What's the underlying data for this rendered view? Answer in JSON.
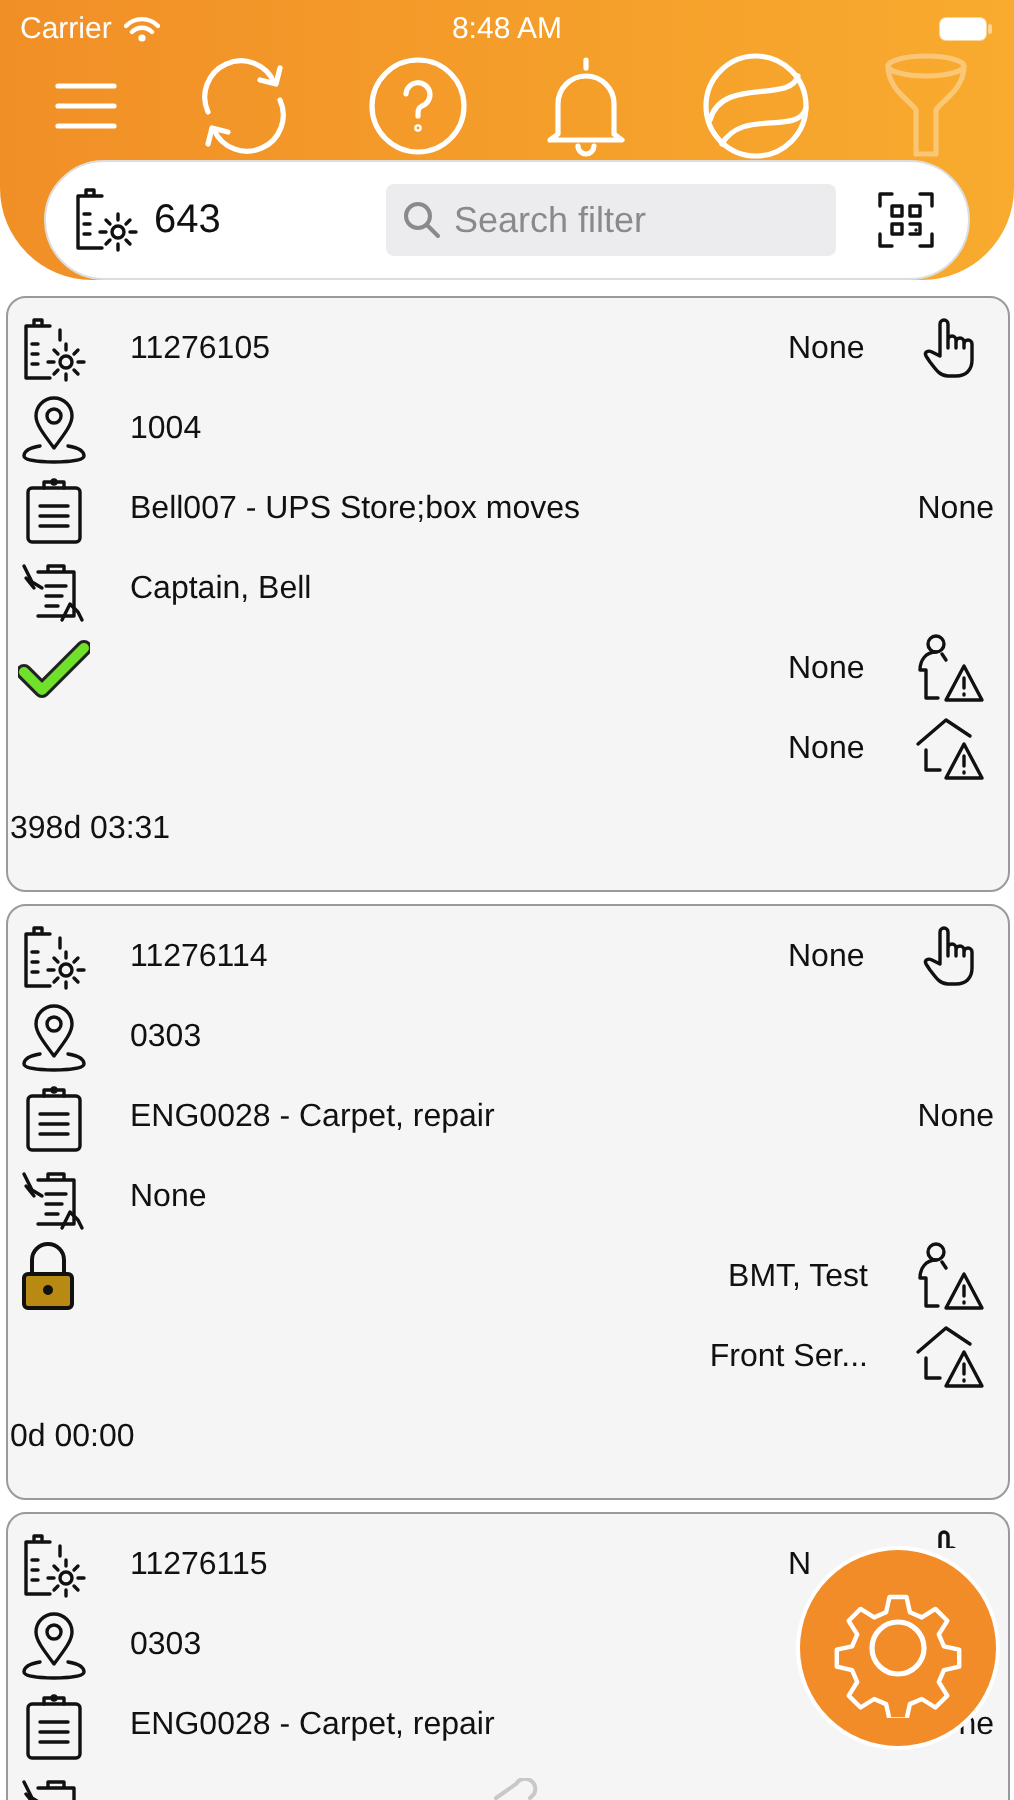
{
  "status_bar": {
    "carrier": "Carrier",
    "time": "8:48 AM"
  },
  "toolbar": {
    "filter_disabled": true
  },
  "search": {
    "count": "643",
    "placeholder": "Search filter"
  },
  "cards": [
    {
      "done": true,
      "locked": false,
      "id": "11276105",
      "id_status": "None",
      "location": "1004",
      "task": "Bell007 - UPS Store;box moves",
      "task_status": "None",
      "assignee": "Captain, Bell",
      "person": "None",
      "place": "None",
      "elapsed": "398d 03:31"
    },
    {
      "done": false,
      "locked": true,
      "id": "11276114",
      "id_status": "None",
      "location": "0303",
      "task": "ENG0028 - Carpet, repair",
      "task_status": "None",
      "assignee": "None",
      "person": "BMT, Test",
      "place": "Front Ser...",
      "elapsed": "0d 00:00"
    },
    {
      "id": "11276115",
      "id_status": "N",
      "location": "0303",
      "task": "ENG0028 - Carpet, repair",
      "task_status": "ne"
    }
  ]
}
